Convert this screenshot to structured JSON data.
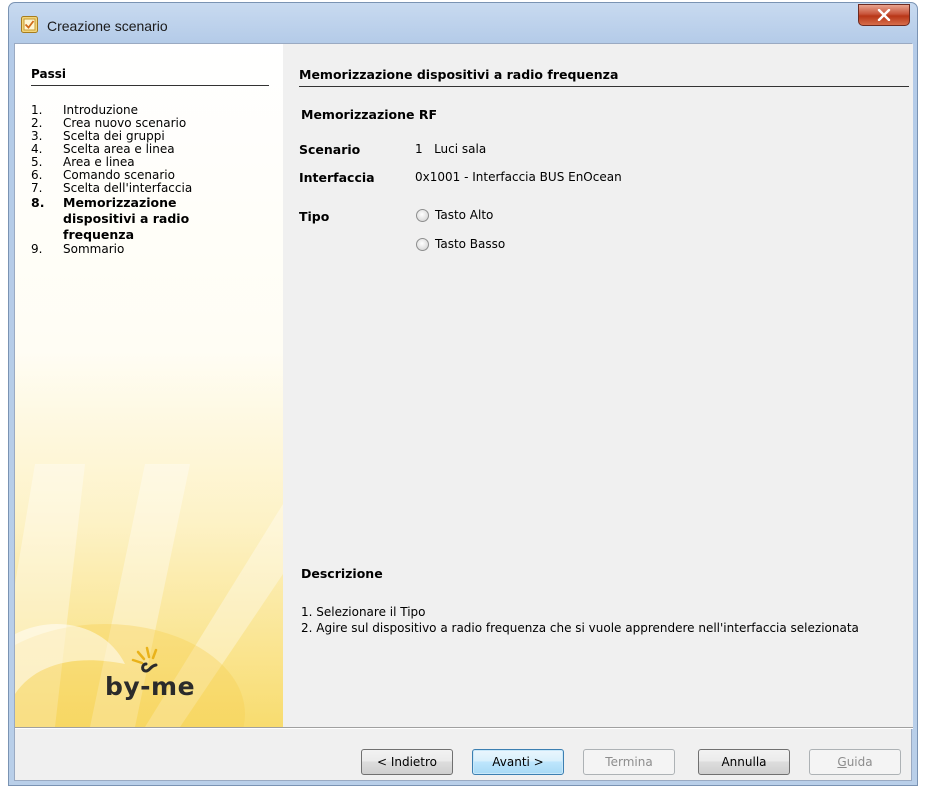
{
  "window": {
    "title": "Creazione scenario",
    "close_label": "x"
  },
  "sidebar": {
    "title": "Passi",
    "steps": [
      {
        "num": "1.",
        "label": "Introduzione"
      },
      {
        "num": "2.",
        "label": "Crea nuovo scenario"
      },
      {
        "num": "3.",
        "label": "Scelta dei gruppi"
      },
      {
        "num": "4.",
        "label": "Scelta area e linea"
      },
      {
        "num": "5.",
        "label": "Area e linea"
      },
      {
        "num": "6.",
        "label": "Comando scenario"
      },
      {
        "num": "7.",
        "label": "Scelta dell'interfaccia"
      },
      {
        "num": "8.",
        "label": "Memorizzazione dispositivi a radio frequenza"
      },
      {
        "num": "9.",
        "label": "Sommario"
      }
    ],
    "current_step": 8,
    "logo": "by-me"
  },
  "main": {
    "title": "Memorizzazione dispositivi a radio frequenza",
    "section_title": "Memorizzazione RF",
    "scenario_label": "Scenario",
    "scenario_value": "1   Luci sala",
    "interfaccia_label": "Interfaccia",
    "interfaccia_value": "0x1001 - Interfaccia BUS EnOcean",
    "tipo_label": "Tipo",
    "tipo_options": [
      {
        "label": "Tasto Alto",
        "checked": false
      },
      {
        "label": "Tasto Basso",
        "checked": false
      }
    ],
    "description_title": "Descrizione",
    "description_line1": "1. Selezionare il Tipo",
    "description_line2": "2. Agire sul dispositivo a radio frequenza che si vuole apprendere nell'interfaccia selezionata"
  },
  "buttons": {
    "back": "< Indietro",
    "next": "Avanti >",
    "finish": "Termina",
    "cancel": "Annulla",
    "help_prefix": "G",
    "help_rest": "uida"
  },
  "colors": {
    "accent_blue": "#3c7fb1",
    "sidebar_gold": "#f8dc6f",
    "close_red": "#c8553b"
  }
}
